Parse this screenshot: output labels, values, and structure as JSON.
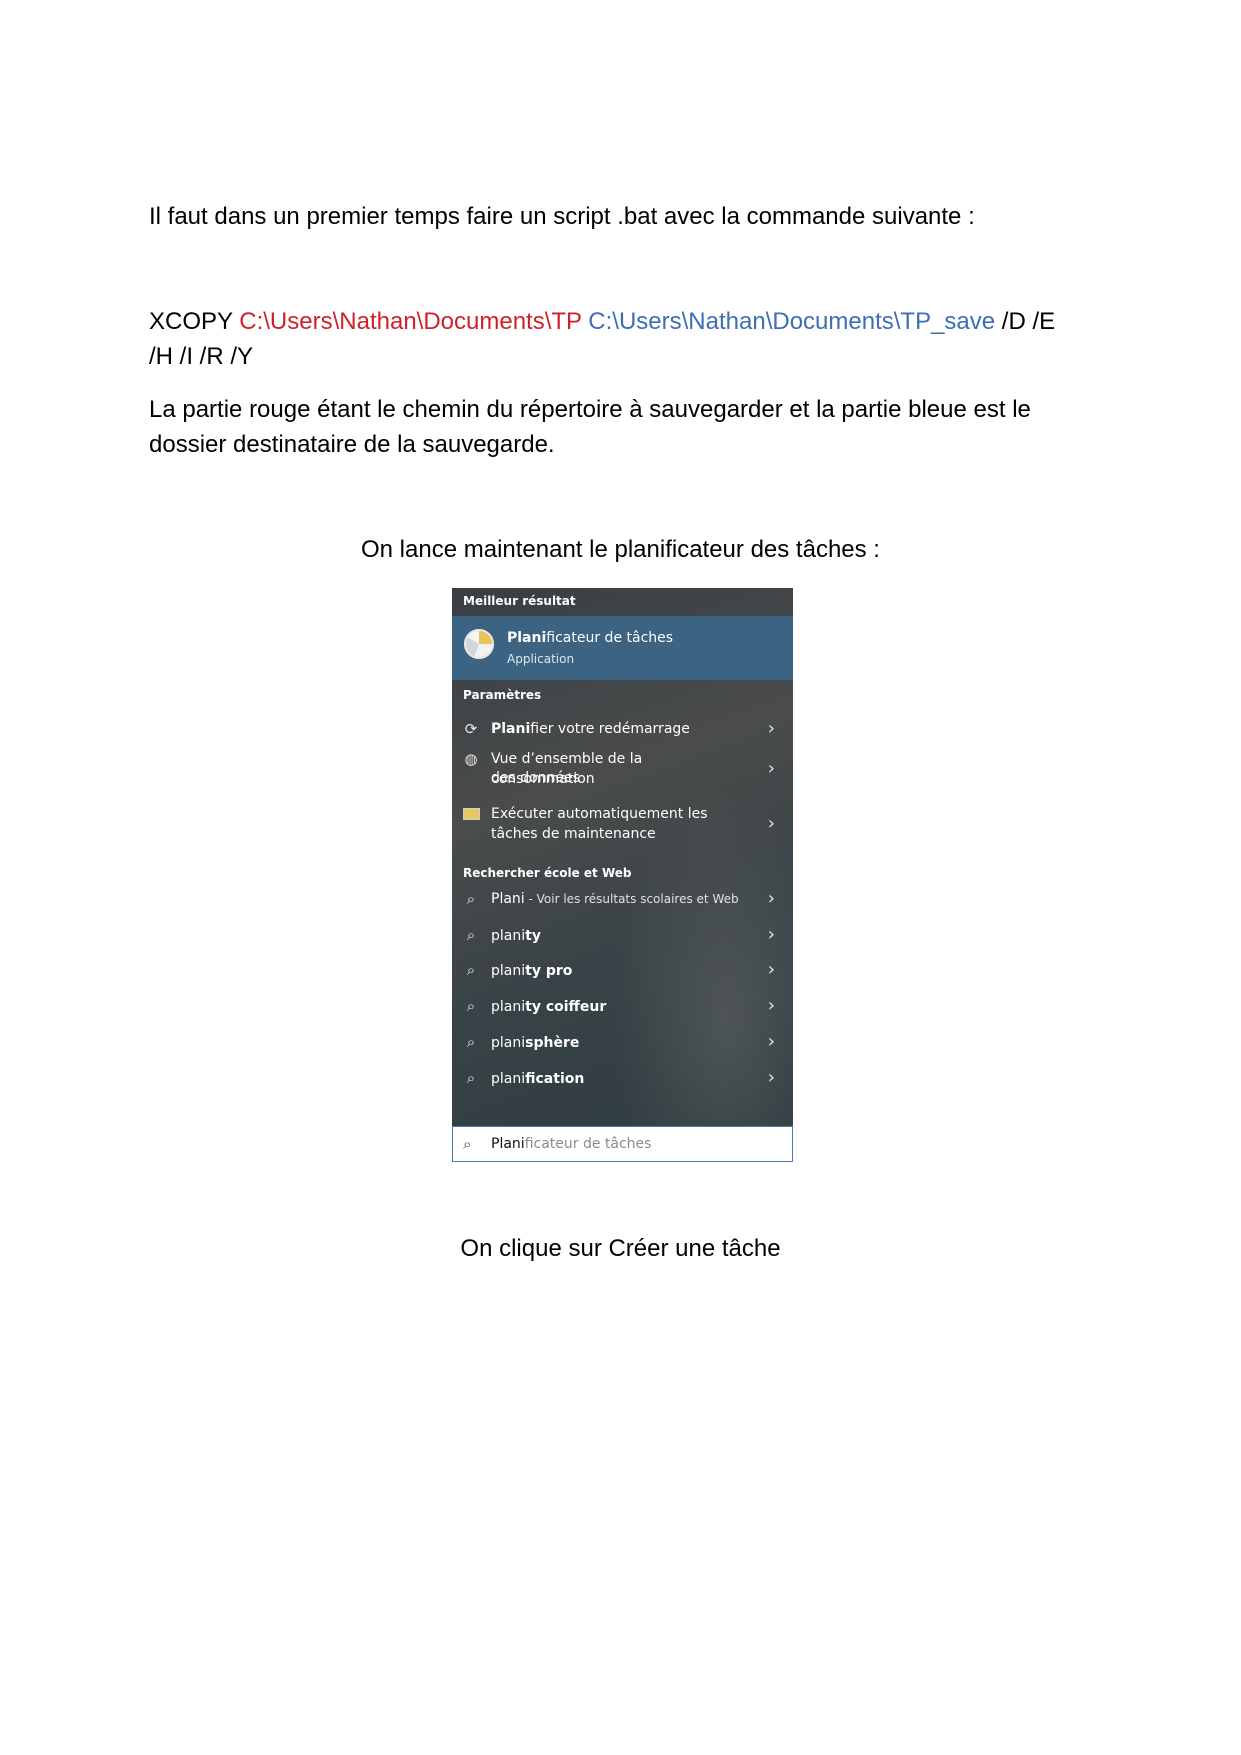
{
  "intro": "Il faut dans un premier temps faire un script .bat avec la commande suivante :",
  "command": {
    "cmd": "XCOPY",
    "source": "C:\\Users\\Nathan\\Documents\\TP",
    "destination": "C:\\Users\\Nathan\\Documents\\TP_save",
    "flags_line1": "/D /E",
    "flags_line2": "/H /I /R /Y"
  },
  "explanation_line1": "La partie rouge étant le chemin du répertoire à sauvegarder et la partie bleue est le",
  "explanation_line2": "dossier destinataire de la sauvegarde.",
  "step_launch": "On lance maintenant le planificateur des tâches :",
  "step_create": "On clique sur Créer une tâche",
  "search_panel": {
    "best_header": "Meilleur résultat",
    "best_title_bold": "Plani",
    "best_title_rest": "ficateur de tâches",
    "best_subtitle": "Application",
    "settings_header": "Paramètres",
    "settings": [
      {
        "bold": "Plani",
        "rest": "fier votre redémarrage",
        "icon": "refresh-icon"
      },
      {
        "line1": "Vue d’ensemble de la consommation",
        "line2": "des données",
        "icon": "globe-icon"
      },
      {
        "line1": "Exécuter automatiquement les",
        "line2": "tâches de maintenance",
        "icon": "maintenance-icon"
      }
    ],
    "web_header": "Rechercher école et Web",
    "web": [
      {
        "plain": "Plani",
        "hint": " - Voir les résultats scolaires et Web"
      },
      {
        "plain": "plani",
        "bold": "ty"
      },
      {
        "plain": "plani",
        "bold": "ty pro"
      },
      {
        "plain": "plani",
        "bold": "ty coiffeur"
      },
      {
        "plain": "plani",
        "bold": "sphère"
      },
      {
        "plain": "plani",
        "bold": "fication"
      }
    ],
    "search_typed": "Plani",
    "search_rest": "ficateur de tâches"
  }
}
